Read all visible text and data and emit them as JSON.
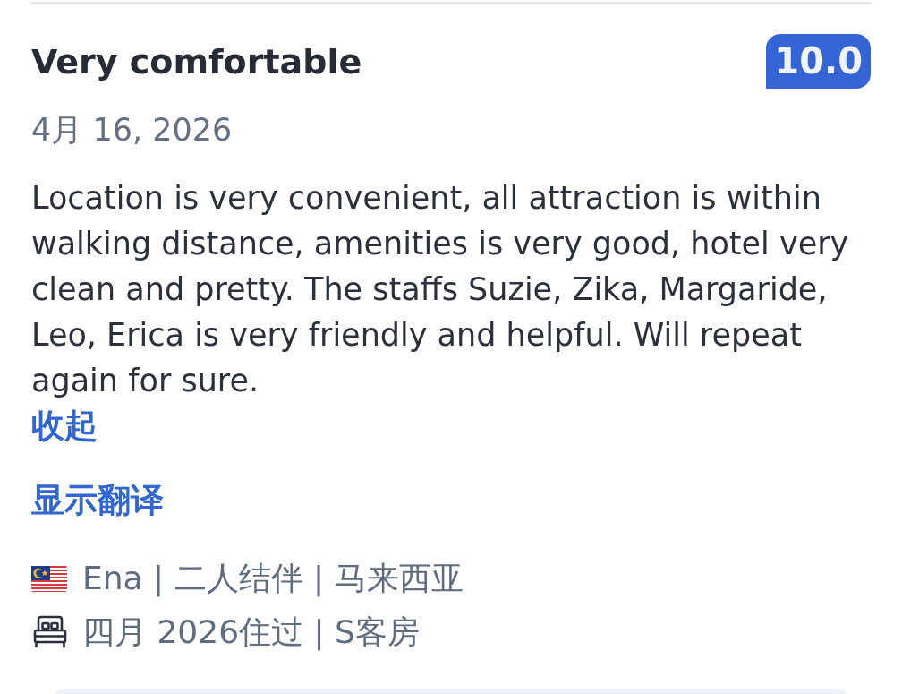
{
  "review": {
    "title": "Very comfortable",
    "score": "10.0",
    "date": "4月 16, 2026",
    "text": "Location is very convenient, all attraction is within walking distance, amenities is very good, hotel very clean and pretty. The staffs Suzie, Zika, Margaride, Leo, Erica is very friendly and helpful. Will repeat again for sure.",
    "collapse_link": "收起",
    "translate_link": "显示翻译",
    "reviewer_line": "Ena | 二人结伴 | 马来西亚",
    "stay_line": "四月 2026住过 | S客房"
  }
}
